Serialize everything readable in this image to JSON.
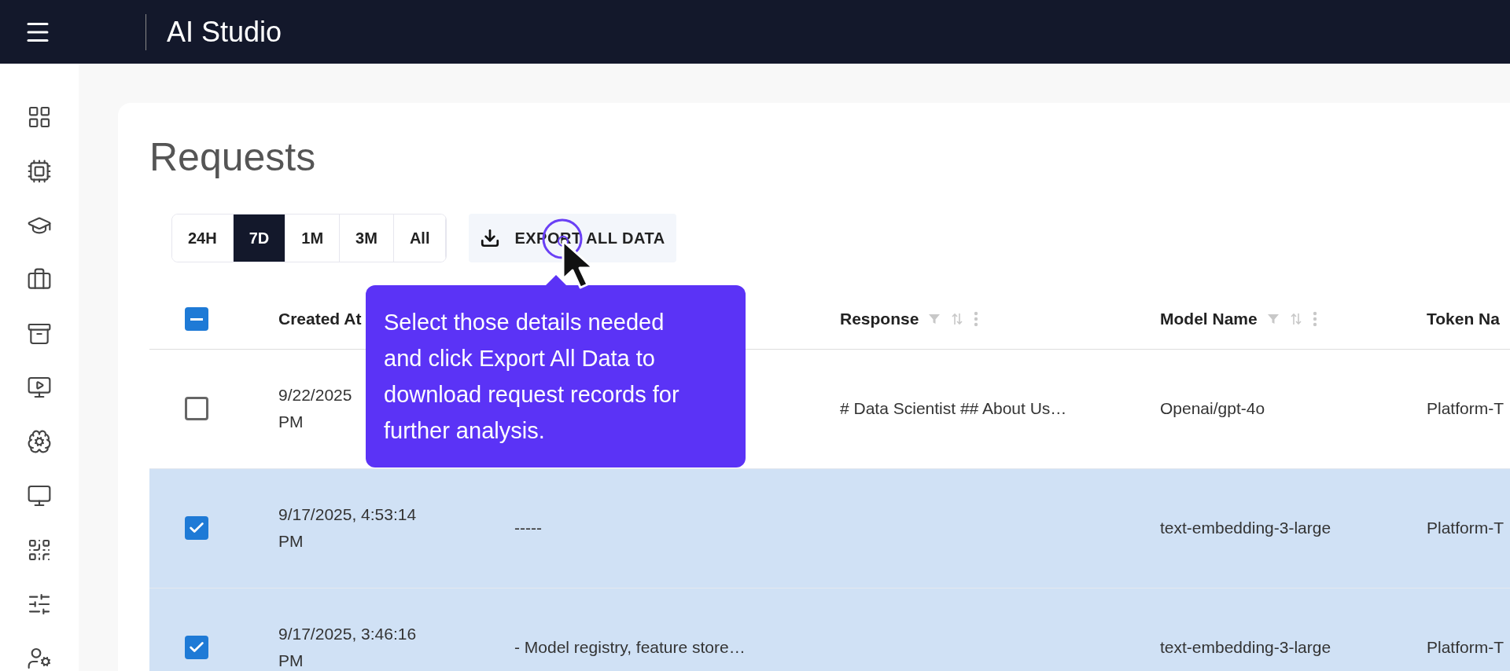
{
  "app_bar": {
    "title": "AI Studio"
  },
  "page": {
    "title": "Requests"
  },
  "ranges": [
    {
      "label": "24H",
      "selected": false
    },
    {
      "label": "7D",
      "selected": true
    },
    {
      "label": "1M",
      "selected": false
    },
    {
      "label": "3M",
      "selected": false
    },
    {
      "label": "All",
      "selected": false
    }
  ],
  "export_button": {
    "label": "EXPORT ALL DATA"
  },
  "table": {
    "select_all": {
      "indeterminate": true
    },
    "columns": [
      {
        "label": "Created At"
      },
      {
        "label": "Response",
        "tools": true
      },
      {
        "label": "Model Name",
        "tools": true
      },
      {
        "label": "Token Na"
      }
    ],
    "rows": [
      {
        "checked": false,
        "created_at": [
          "9/22/2025",
          "PM"
        ],
        "response": "# Data Scientist ## About Us…",
        "model": "Openai/gpt-4o",
        "token": "Platform-T"
      },
      {
        "checked": true,
        "created_at": [
          "9/17/2025, 4:53:14",
          "PM"
        ],
        "column_2": "-----",
        "model": "text-embedding-3-large",
        "token": "Platform-T"
      },
      {
        "checked": true,
        "created_at": [
          "9/17/2025, 3:46:16",
          "PM"
        ],
        "column_2": "- Model registry, feature store…",
        "model": "text-embedding-3-large",
        "token": "Platform-T"
      }
    ]
  },
  "tooltip": {
    "text": "Select those details needed and click Export All Data to download request records for further analysis."
  }
}
